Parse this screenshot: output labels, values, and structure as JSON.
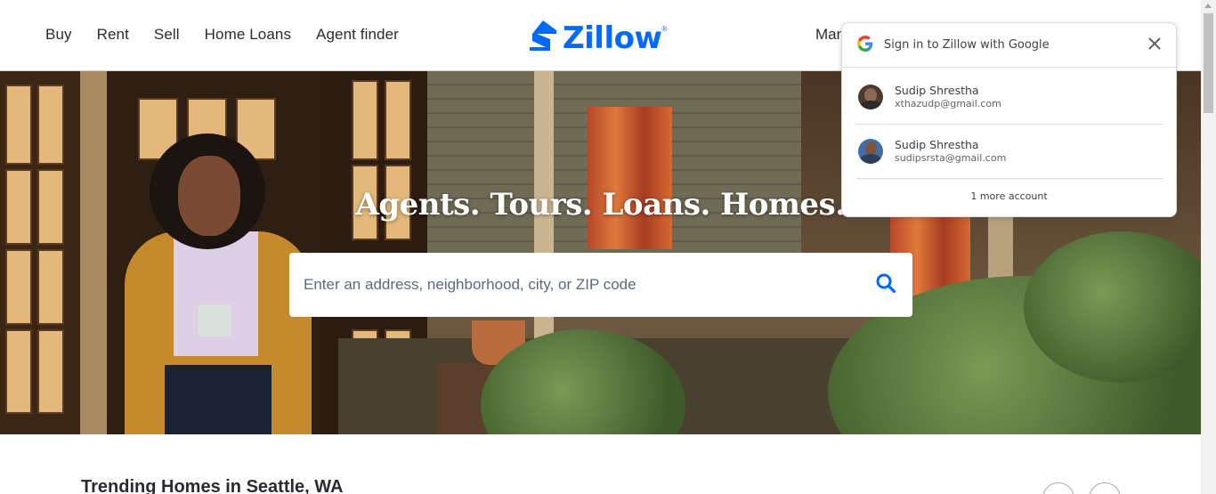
{
  "header": {
    "nav_left": [
      "Buy",
      "Rent",
      "Sell",
      "Home Loans",
      "Agent finder"
    ],
    "logo_text": "Zillow",
    "logo_reg": "®",
    "nav_right_partial": "Man"
  },
  "hero": {
    "title": "Agents. Tours. Loans. Homes.",
    "search_placeholder": "Enter an address, neighborhood, city, or ZIP code"
  },
  "trending": {
    "title": "Trending Homes in Seattle, WA"
  },
  "google_popup": {
    "title": "Sign in to Zillow with Google",
    "accounts": [
      {
        "name": "Sudip Shrestha",
        "email": "xthazudp@gmail.com"
      },
      {
        "name": "Sudip Shrestha",
        "email": "sudipsrsta@gmail.com"
      }
    ],
    "more": "1 more account"
  },
  "colors": {
    "brand_blue": "#006aff",
    "text_dark": "#2a2a33",
    "google_border": "#dadce0"
  }
}
